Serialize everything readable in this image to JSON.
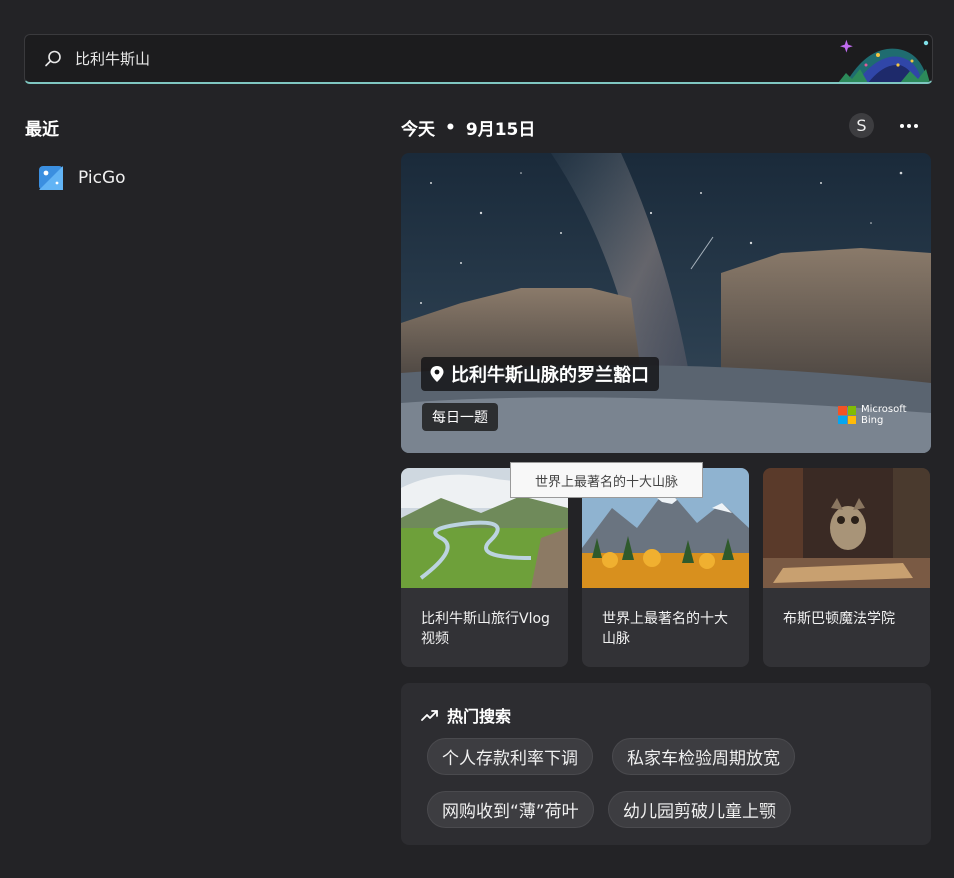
{
  "search": {
    "query": "比利牛斯山"
  },
  "recent": {
    "title": "最近",
    "items": [
      {
        "label": "PicGo",
        "icon": "picgo-app-icon"
      }
    ]
  },
  "today": {
    "label": "今天",
    "separator": "•",
    "date": "9月15日",
    "avatar_letter": "S"
  },
  "hero": {
    "location": "比利牛斯山脉的罗兰豁口",
    "tag": "每日一题",
    "brand_line1": "Microsoft",
    "brand_line2": "Bing"
  },
  "cards": [
    {
      "text": "比利牛斯山旅行Vlog视频"
    },
    {
      "text": "世界上最著名的十大山脉"
    },
    {
      "text": "布斯巴顿魔法学院"
    }
  ],
  "tooltip": "世界上最著名的十大山脉",
  "trending": {
    "title": "热门搜索",
    "chips": [
      "个人存款利率下调",
      "私家车检验周期放宽",
      "网购收到“薄”荷叶",
      "幼儿园剪破儿童上颚"
    ]
  },
  "colors": {
    "background": "#232326",
    "accent": "#7fc6c1",
    "card": "#323236"
  }
}
